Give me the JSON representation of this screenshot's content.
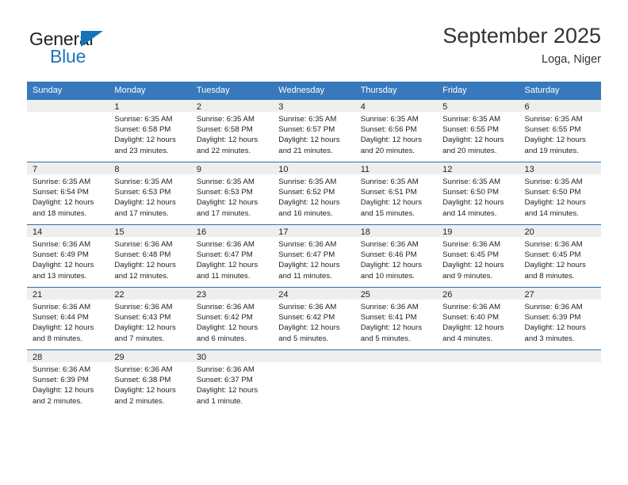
{
  "brand": {
    "name_top": "General",
    "name_bottom": "Blue",
    "color_dark": "#231f20",
    "color_blue": "#1b75bb"
  },
  "header": {
    "title": "September 2025",
    "subtitle": "Loga, Niger"
  },
  "theme": {
    "header_row_bg": "#3878bc",
    "header_row_text": "#ffffff",
    "week_separator": "#2e6fae",
    "daynum_band_bg": "#eeeeee",
    "page_bg": "#ffffff"
  },
  "weekday_headers": [
    "Sunday",
    "Monday",
    "Tuesday",
    "Wednesday",
    "Thursday",
    "Friday",
    "Saturday"
  ],
  "weeks": [
    [
      {
        "day": "",
        "lines": []
      },
      {
        "day": "1",
        "lines": [
          "Sunrise: 6:35 AM",
          "Sunset: 6:58 PM",
          "Daylight: 12 hours",
          "and 23 minutes."
        ]
      },
      {
        "day": "2",
        "lines": [
          "Sunrise: 6:35 AM",
          "Sunset: 6:58 PM",
          "Daylight: 12 hours",
          "and 22 minutes."
        ]
      },
      {
        "day": "3",
        "lines": [
          "Sunrise: 6:35 AM",
          "Sunset: 6:57 PM",
          "Daylight: 12 hours",
          "and 21 minutes."
        ]
      },
      {
        "day": "4",
        "lines": [
          "Sunrise: 6:35 AM",
          "Sunset: 6:56 PM",
          "Daylight: 12 hours",
          "and 20 minutes."
        ]
      },
      {
        "day": "5",
        "lines": [
          "Sunrise: 6:35 AM",
          "Sunset: 6:55 PM",
          "Daylight: 12 hours",
          "and 20 minutes."
        ]
      },
      {
        "day": "6",
        "lines": [
          "Sunrise: 6:35 AM",
          "Sunset: 6:55 PM",
          "Daylight: 12 hours",
          "and 19 minutes."
        ]
      }
    ],
    [
      {
        "day": "7",
        "lines": [
          "Sunrise: 6:35 AM",
          "Sunset: 6:54 PM",
          "Daylight: 12 hours",
          "and 18 minutes."
        ]
      },
      {
        "day": "8",
        "lines": [
          "Sunrise: 6:35 AM",
          "Sunset: 6:53 PM",
          "Daylight: 12 hours",
          "and 17 minutes."
        ]
      },
      {
        "day": "9",
        "lines": [
          "Sunrise: 6:35 AM",
          "Sunset: 6:53 PM",
          "Daylight: 12 hours",
          "and 17 minutes."
        ]
      },
      {
        "day": "10",
        "lines": [
          "Sunrise: 6:35 AM",
          "Sunset: 6:52 PM",
          "Daylight: 12 hours",
          "and 16 minutes."
        ]
      },
      {
        "day": "11",
        "lines": [
          "Sunrise: 6:35 AM",
          "Sunset: 6:51 PM",
          "Daylight: 12 hours",
          "and 15 minutes."
        ]
      },
      {
        "day": "12",
        "lines": [
          "Sunrise: 6:35 AM",
          "Sunset: 6:50 PM",
          "Daylight: 12 hours",
          "and 14 minutes."
        ]
      },
      {
        "day": "13",
        "lines": [
          "Sunrise: 6:35 AM",
          "Sunset: 6:50 PM",
          "Daylight: 12 hours",
          "and 14 minutes."
        ]
      }
    ],
    [
      {
        "day": "14",
        "lines": [
          "Sunrise: 6:36 AM",
          "Sunset: 6:49 PM",
          "Daylight: 12 hours",
          "and 13 minutes."
        ]
      },
      {
        "day": "15",
        "lines": [
          "Sunrise: 6:36 AM",
          "Sunset: 6:48 PM",
          "Daylight: 12 hours",
          "and 12 minutes."
        ]
      },
      {
        "day": "16",
        "lines": [
          "Sunrise: 6:36 AM",
          "Sunset: 6:47 PM",
          "Daylight: 12 hours",
          "and 11 minutes."
        ]
      },
      {
        "day": "17",
        "lines": [
          "Sunrise: 6:36 AM",
          "Sunset: 6:47 PM",
          "Daylight: 12 hours",
          "and 11 minutes."
        ]
      },
      {
        "day": "18",
        "lines": [
          "Sunrise: 6:36 AM",
          "Sunset: 6:46 PM",
          "Daylight: 12 hours",
          "and 10 minutes."
        ]
      },
      {
        "day": "19",
        "lines": [
          "Sunrise: 6:36 AM",
          "Sunset: 6:45 PM",
          "Daylight: 12 hours",
          "and 9 minutes."
        ]
      },
      {
        "day": "20",
        "lines": [
          "Sunrise: 6:36 AM",
          "Sunset: 6:45 PM",
          "Daylight: 12 hours",
          "and 8 minutes."
        ]
      }
    ],
    [
      {
        "day": "21",
        "lines": [
          "Sunrise: 6:36 AM",
          "Sunset: 6:44 PM",
          "Daylight: 12 hours",
          "and 8 minutes."
        ]
      },
      {
        "day": "22",
        "lines": [
          "Sunrise: 6:36 AM",
          "Sunset: 6:43 PM",
          "Daylight: 12 hours",
          "and 7 minutes."
        ]
      },
      {
        "day": "23",
        "lines": [
          "Sunrise: 6:36 AM",
          "Sunset: 6:42 PM",
          "Daylight: 12 hours",
          "and 6 minutes."
        ]
      },
      {
        "day": "24",
        "lines": [
          "Sunrise: 6:36 AM",
          "Sunset: 6:42 PM",
          "Daylight: 12 hours",
          "and 5 minutes."
        ]
      },
      {
        "day": "25",
        "lines": [
          "Sunrise: 6:36 AM",
          "Sunset: 6:41 PM",
          "Daylight: 12 hours",
          "and 5 minutes."
        ]
      },
      {
        "day": "26",
        "lines": [
          "Sunrise: 6:36 AM",
          "Sunset: 6:40 PM",
          "Daylight: 12 hours",
          "and 4 minutes."
        ]
      },
      {
        "day": "27",
        "lines": [
          "Sunrise: 6:36 AM",
          "Sunset: 6:39 PM",
          "Daylight: 12 hours",
          "and 3 minutes."
        ]
      }
    ],
    [
      {
        "day": "28",
        "lines": [
          "Sunrise: 6:36 AM",
          "Sunset: 6:39 PM",
          "Daylight: 12 hours",
          "and 2 minutes."
        ]
      },
      {
        "day": "29",
        "lines": [
          "Sunrise: 6:36 AM",
          "Sunset: 6:38 PM",
          "Daylight: 12 hours",
          "and 2 minutes."
        ]
      },
      {
        "day": "30",
        "lines": [
          "Sunrise: 6:36 AM",
          "Sunset: 6:37 PM",
          "Daylight: 12 hours",
          "and 1 minute."
        ]
      },
      {
        "day": "",
        "lines": []
      },
      {
        "day": "",
        "lines": []
      },
      {
        "day": "",
        "lines": []
      },
      {
        "day": "",
        "lines": []
      }
    ]
  ]
}
